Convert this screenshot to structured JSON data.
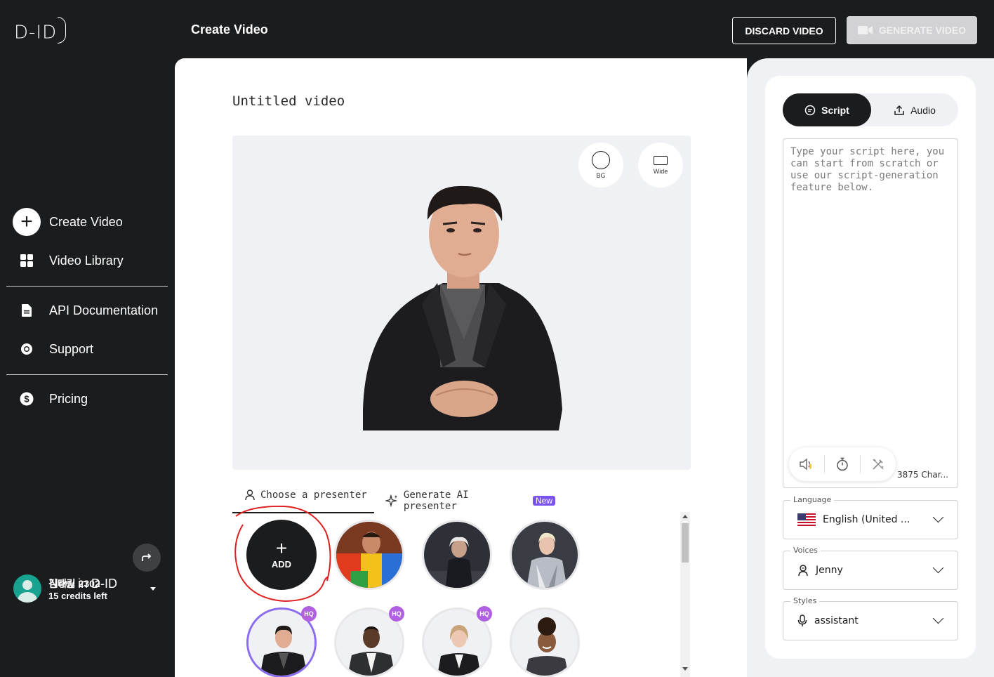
{
  "brand": {
    "logo_text": "D-ID"
  },
  "header": {
    "title": "Create Video",
    "discard_label": "DISCARD VIDEO",
    "generate_label": "GENERATE VIDEO"
  },
  "sidebar": {
    "items": [
      {
        "label": "Create Video",
        "icon": "plus-circle-icon"
      },
      {
        "label": "Video Library",
        "icon": "grid-icon"
      },
      {
        "label": "API Documentation",
        "icon": "document-icon"
      },
      {
        "label": "Support",
        "icon": "lifebuoy-icon"
      },
      {
        "label": "Pricing",
        "icon": "dollar-icon"
      },
      {
        "label": "New in D-ID",
        "icon": "party-popper-icon"
      }
    ],
    "user": {
      "name": "김태림 2302",
      "credits": "15 credits left"
    }
  },
  "main": {
    "video_title": "Untitled video",
    "preview_buttons": [
      {
        "label": "BG"
      },
      {
        "label": "Wide"
      }
    ],
    "tabs": [
      {
        "label": "Choose a presenter",
        "active": true
      },
      {
        "label": "Generate AI presenter",
        "badge": "New"
      }
    ],
    "add_label": "ADD",
    "hq_badge": "HQ",
    "presenters": [
      {
        "style": "colorful-jacket"
      },
      {
        "style": "old-man-dark"
      },
      {
        "style": "silver-jacket"
      },
      {
        "style": "man-black-blazer",
        "hq": true,
        "selected": true
      },
      {
        "style": "man-gray-blazer",
        "hq": true
      },
      {
        "style": "woman-black-blazer",
        "hq": true
      },
      {
        "style": "woman-smiling"
      }
    ]
  },
  "right_panel": {
    "tabs": [
      {
        "label": "Script",
        "active": true
      },
      {
        "label": "Audio"
      }
    ],
    "script_placeholder": "Type your script here, you can start from scratch or use our script-generation feature below.",
    "char_count": "3875 Char...",
    "fields": [
      {
        "label": "Language",
        "value": "English (United ...",
        "icon": "us-flag-icon"
      },
      {
        "label": "Voices",
        "value": "Jenny",
        "icon": "voice-person-icon"
      },
      {
        "label": "Styles",
        "value": "assistant",
        "icon": "microphone-icon"
      }
    ]
  },
  "colors": {
    "dark": "#1b1c1e",
    "panel_bg": "#f0f1f5",
    "accent_purple": "#7b53f0",
    "hq_purple": "#b060e0",
    "annotation_red": "#e02020"
  }
}
